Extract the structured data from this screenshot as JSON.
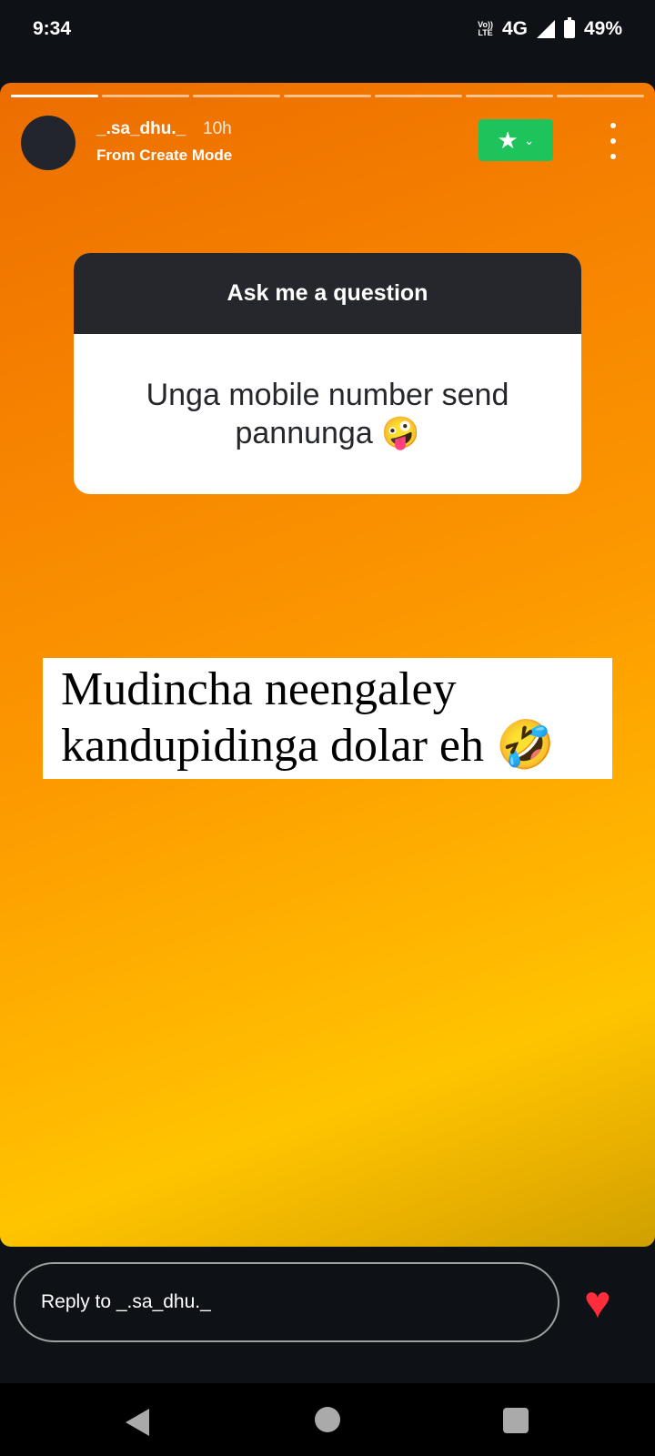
{
  "status_bar": {
    "time": "9:34",
    "volte_top": "Vo))",
    "volte_bottom": "LTE",
    "network": "4G",
    "battery": "49%"
  },
  "story": {
    "progress": {
      "segments": 7,
      "active_index": 0
    },
    "username": "_.sa_dhu._",
    "time_ago": "10h",
    "subtitle": "From Create Mode",
    "close_friends_icon": "star-icon",
    "question_sticker": {
      "header": "Ask me a question",
      "question": "Unga mobile number send pannunga 🤪"
    },
    "caption": "Mudincha neengaley kandupidinga dolar eh 🤣",
    "colors": {
      "gradient_start": "#ec6d00",
      "gradient_end": "#ffc400",
      "badge": "#1fc35b"
    }
  },
  "reply": {
    "placeholder": "Reply to _.sa_dhu._",
    "like_icon": "heart-icon",
    "heart_color": "#ff2d3b"
  },
  "nav": {
    "back": "back-icon",
    "home": "home-icon",
    "recents": "recents-icon"
  }
}
